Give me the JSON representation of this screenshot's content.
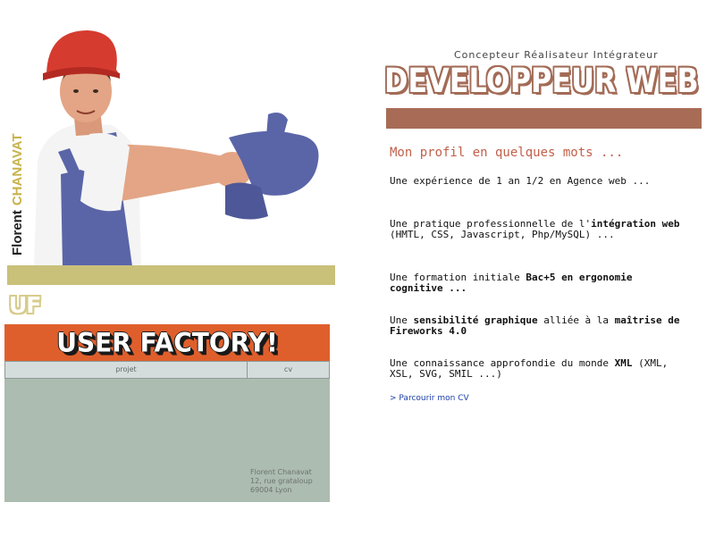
{
  "sidebar": {
    "first_name": "Florent",
    "last_name": "CHANAVAT"
  },
  "brand": {
    "logo_mark": "UF",
    "name": "USER FACTORY!",
    "colors": {
      "banner": "#df5f2c",
      "olive": "#c9c07a",
      "panel": "#acbcb0"
    }
  },
  "nav": {
    "tabs": [
      {
        "label": "projet"
      },
      {
        "label": "cv"
      }
    ]
  },
  "address": {
    "name": "Florent Chanavat",
    "street": "12, rue grataloup",
    "city": "69004 Lyon"
  },
  "header": {
    "tagline": "Concepteur Réalisateur Intégrateur",
    "title": "DEVELOPPEUR WEB",
    "accent_color": "#a86c56"
  },
  "profile": {
    "heading": "Mon profil en quelques mots ...",
    "items": [
      {
        "parts": [
          {
            "text": "Une expérience de 1 an 1/2 en Agence web ...",
            "bold": false
          }
        ]
      },
      {
        "parts": [
          {
            "text": "Une pratique professionnelle de l'",
            "bold": false
          },
          {
            "text": "intégration web",
            "bold": true
          },
          {
            "text": " (HMTL, CSS, Javascript, Php/MySQL) ...",
            "bold": false
          }
        ]
      },
      {
        "parts": [
          {
            "text": "Une formation initiale ",
            "bold": false
          },
          {
            "text": "Bac+5 en ergonomie cognitive ...",
            "bold": true
          }
        ]
      },
      {
        "parts": [
          {
            "text": "Une ",
            "bold": false
          },
          {
            "text": "sensibilité graphique",
            "bold": true
          },
          {
            "text": " alliée à la ",
            "bold": false
          },
          {
            "text": "maîtrise de Fireworks 4.0",
            "bold": true
          }
        ]
      },
      {
        "parts": [
          {
            "text": "Une connaissance approfondie du monde ",
            "bold": false
          },
          {
            "text": "XML",
            "bold": true
          },
          {
            "text": " (XML, XSL, SVG, SMIL ...)",
            "bold": false
          }
        ]
      }
    ],
    "cv_link": "> Parcourir mon CV"
  },
  "illustration": {
    "icon": "construction-worker-illustration"
  }
}
